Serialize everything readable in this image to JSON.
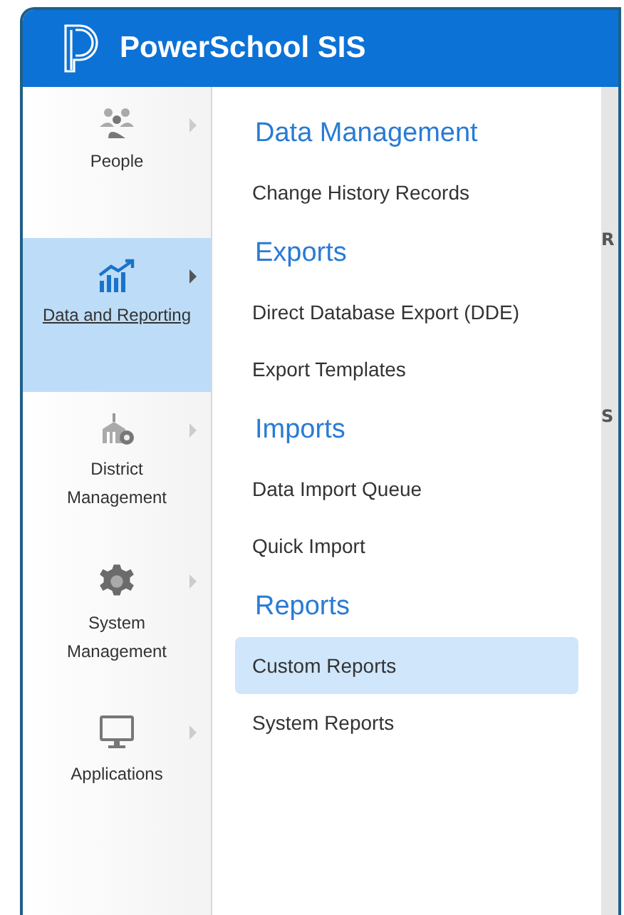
{
  "app": {
    "title": "PowerSchool SIS"
  },
  "sidebar": {
    "items": [
      {
        "label": "People",
        "kind": "people",
        "selected": false
      },
      {
        "label": "Data and Reporting",
        "kind": "data",
        "selected": true
      },
      {
        "label": "District Management",
        "kind": "district",
        "selected": false
      },
      {
        "label": "System Management",
        "kind": "system",
        "selected": false
      },
      {
        "label": "Applications",
        "kind": "applications",
        "selected": false
      }
    ]
  },
  "menu": {
    "sections": [
      {
        "heading": "Data Management",
        "items": [
          {
            "label": "Change History Records",
            "selected": false
          }
        ]
      },
      {
        "heading": "Exports",
        "items": [
          {
            "label": "Direct Database Export (DDE)",
            "selected": false
          },
          {
            "label": "Export Templates",
            "selected": false
          }
        ]
      },
      {
        "heading": "Imports",
        "items": [
          {
            "label": "Data Import Queue",
            "selected": false
          },
          {
            "label": "Quick Import",
            "selected": false
          }
        ]
      },
      {
        "heading": "Reports",
        "items": [
          {
            "label": "Custom Reports",
            "selected": true
          },
          {
            "label": "System Reports",
            "selected": false
          }
        ]
      }
    ]
  },
  "background_page": {
    "letters": [
      "R",
      "S"
    ]
  }
}
